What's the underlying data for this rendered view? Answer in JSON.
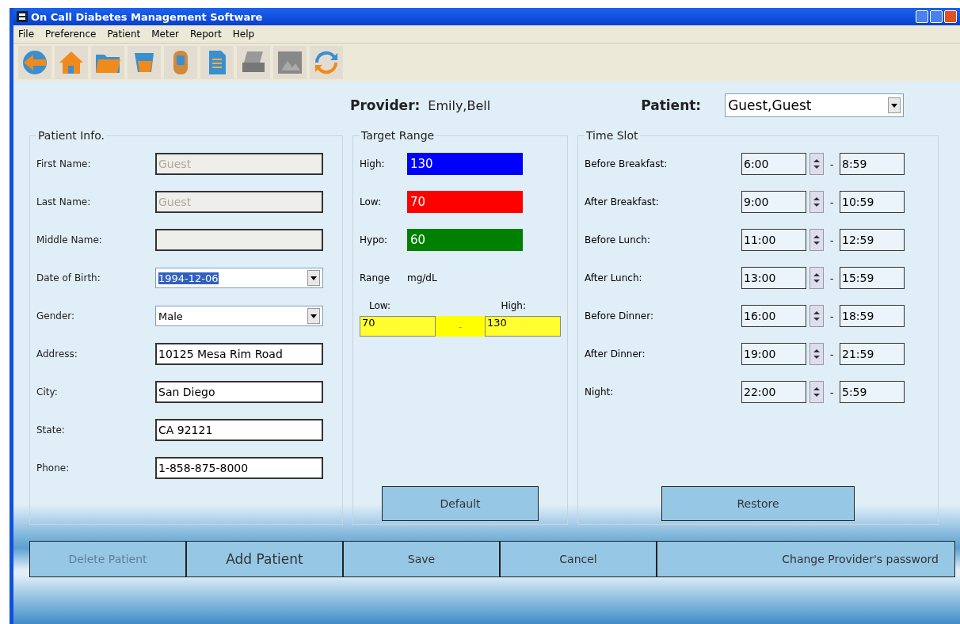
{
  "window": {
    "title": "On Call Diabetes Management Software"
  },
  "menu": [
    "File",
    "Preference",
    "Patient",
    "Meter",
    "Report",
    "Help"
  ],
  "toolbar": [
    {
      "kind": "back"
    },
    {
      "kind": "home"
    },
    {
      "kind": "folder"
    },
    {
      "kind": "patient"
    },
    {
      "kind": "meter"
    },
    {
      "kind": "document"
    },
    {
      "kind": "printer"
    },
    {
      "kind": "picture"
    },
    {
      "kind": "sync"
    }
  ],
  "provider": {
    "label": "Provider:",
    "value": "Emily,Bell"
  },
  "patient": {
    "label": "Patient:",
    "value": "Guest,Guest"
  },
  "patient_info": {
    "title": "Patient Info.",
    "fields": [
      {
        "label": "First Name:",
        "value": "Guest",
        "kind": "text",
        "disabled": true,
        "selected": false
      },
      {
        "label": "Last Name:",
        "value": "Guest",
        "kind": "text",
        "disabled": true,
        "selected": false
      },
      {
        "label": "Middle Name:",
        "kind": "text",
        "disabled": true
      },
      {
        "label": "Date of Birth:",
        "value": "1994-12-06",
        "kind": "dropdown",
        "disabled": false,
        "selected": true
      },
      {
        "label": "Gender:",
        "value": "Male",
        "kind": "dropdown",
        "disabled": false,
        "selected": false
      },
      {
        "label": "Address:",
        "value": "10125 Mesa Rim Road",
        "kind": "text",
        "disabled": false,
        "selected": false
      },
      {
        "label": "City:",
        "value": "San Diego",
        "kind": "text",
        "disabled": false,
        "selected": false
      },
      {
        "label": "State:",
        "value": "CA 92121",
        "kind": "text",
        "disabled": false,
        "selected": false
      },
      {
        "label": "Phone:",
        "value": "1-858-875-8000",
        "kind": "text",
        "disabled": false,
        "selected": false
      }
    ]
  },
  "target_range": {
    "title": "Target Range",
    "levels": [
      {
        "label": "High:",
        "value": "130",
        "color": "#0000ff"
      },
      {
        "label": "Low:",
        "value": "70",
        "color": "#ff0000"
      },
      {
        "label": "Hypo:",
        "value": "60",
        "color": "#008000"
      }
    ],
    "range_label": "Range",
    "unit": "mg/dL",
    "low_label": "Low:",
    "high_label": "High:",
    "low": "70",
    "separator": "-",
    "high": "130",
    "button": "Default"
  },
  "time_slot": {
    "title": "Time Slot",
    "slots": [
      {
        "label": "Before Breakfast:",
        "start": "6:00",
        "end": "8:59"
      },
      {
        "label": "After Breakfast:",
        "start": "9:00",
        "end": "10:59"
      },
      {
        "label": "Before Lunch:",
        "start": "11:00",
        "end": "12:59"
      },
      {
        "label": "After Lunch:",
        "start": "13:00",
        "end": "15:59"
      },
      {
        "label": "Before Dinner:",
        "start": "16:00",
        "end": "18:59"
      },
      {
        "label": "After Dinner:",
        "start": "19:00",
        "end": "21:59"
      },
      {
        "label": "Night:",
        "start": "22:00",
        "end": "5:59"
      }
    ],
    "separator": "-",
    "button": "Restore"
  },
  "buttons": [
    {
      "label": "Delete Patient",
      "disabled": true
    },
    {
      "label": "Add Patient",
      "disabled": false
    },
    {
      "label": "Save",
      "disabled": false
    },
    {
      "label": "Cancel",
      "disabled": false
    },
    {
      "label": "Change Provider's password",
      "disabled": false
    }
  ]
}
